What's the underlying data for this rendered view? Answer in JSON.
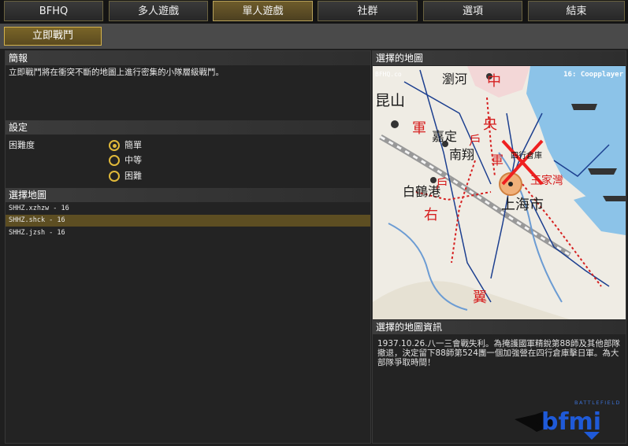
{
  "tabs": [
    {
      "label": "BFHQ"
    },
    {
      "label": "多人遊戲"
    },
    {
      "label": "單人遊戲"
    },
    {
      "label": "社群"
    },
    {
      "label": "選項"
    },
    {
      "label": "結束"
    }
  ],
  "active_tab": "單人遊戲",
  "subnav": {
    "instant_battle": "立即戰鬥"
  },
  "brief": {
    "title": "簡報",
    "text": "立即戰鬥將在衝突不斷的地圖上進行密集的小隊層級戰鬥。"
  },
  "settings": {
    "title": "設定",
    "difficulty_label": "困難度",
    "options": [
      "簡單",
      "中等",
      "困難"
    ],
    "selected": "簡單"
  },
  "map_select": {
    "title": "選擇地圖",
    "items": [
      "SHHZ.xzhzw - 16",
      "SHHZ.shck - 16",
      "SHHZ.jzsh - 16"
    ],
    "selected": "SHHZ.shck - 16"
  },
  "selected_map": {
    "title": "選擇的地圖",
    "overlay_right": "16: Coopplayer",
    "overlay_left": "BFHQ.co",
    "map_labels": {
      "kunshan": "昆山",
      "liuhe": "瀏河",
      "jiading": "嘉定",
      "nanxiang": "南翔",
      "baiheGang": "白鶴港",
      "shanghai": "上海市",
      "wangjiazhai": "王家灣",
      "sihang": "四行倉庫",
      "zhong": "中",
      "yang": "央",
      "jun1": "軍",
      "jun2": "軍",
      "hu1": "戶",
      "hu2": "戶",
      "you": "右",
      "yi": "翼"
    }
  },
  "map_info": {
    "title": "選擇的地圖資訊",
    "text": "1937.10.26.八一三會戰失利。為掩護國軍精銳第88師及其他部隊撤退，決定留下88師第524團一個加強營在四行倉庫擊日軍。為大部隊爭取時間！"
  },
  "logo": {
    "small": "BATTLEFIELD",
    "main": "bfmi"
  },
  "colors": {
    "accent": "#d4b24b",
    "selected_row": "#5d4e22",
    "map_red": "#d62020",
    "map_blue": "#1c3f8f"
  }
}
